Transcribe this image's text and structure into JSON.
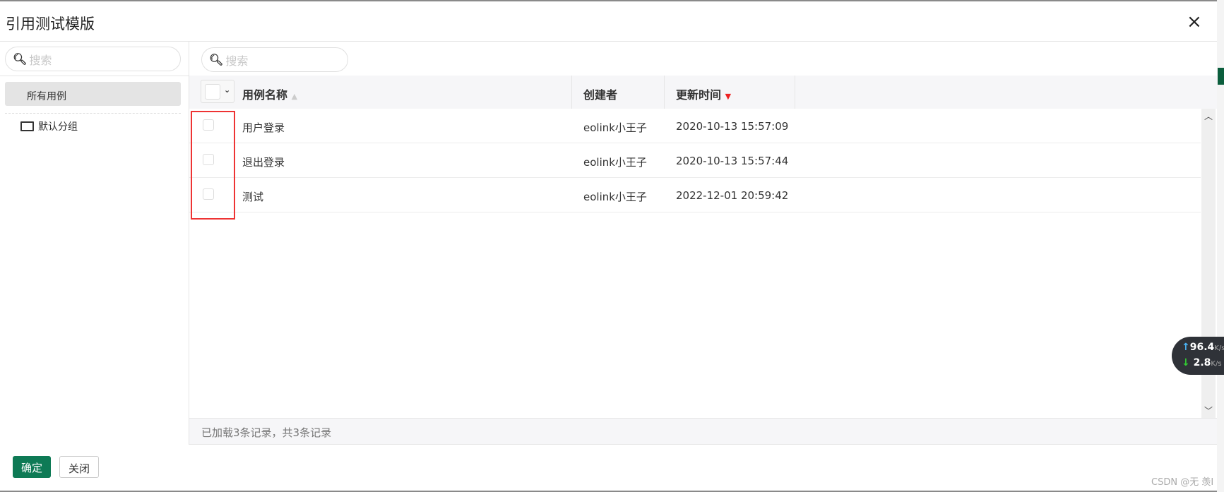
{
  "dialog": {
    "title": "引用测试模版",
    "close_icon": "×"
  },
  "left": {
    "search_placeholder": "搜索",
    "all_cases": "所有用例",
    "groups": [
      "默认分组"
    ]
  },
  "right": {
    "search_placeholder": "搜索",
    "columns": {
      "name": "用例名称",
      "creator": "创建者",
      "updated": "更新时间"
    },
    "rows": [
      {
        "name": "用户登录",
        "creator": "eolink小王子",
        "updated": "2020-10-13 15:57:09"
      },
      {
        "name": "退出登录",
        "creator": "eolink小王子",
        "updated": "2020-10-13 15:57:44"
      },
      {
        "name": "测试",
        "creator": "eolink小王子",
        "updated": "2022-12-01 20:59:42"
      }
    ],
    "status": "已加载3条记录，共3条记录"
  },
  "footer": {
    "confirm": "确定",
    "close": "关闭"
  },
  "speed": {
    "up": "96.4",
    "down": "2.8",
    "unit": "K/s"
  },
  "watermark": "CSDN @无 羡I"
}
